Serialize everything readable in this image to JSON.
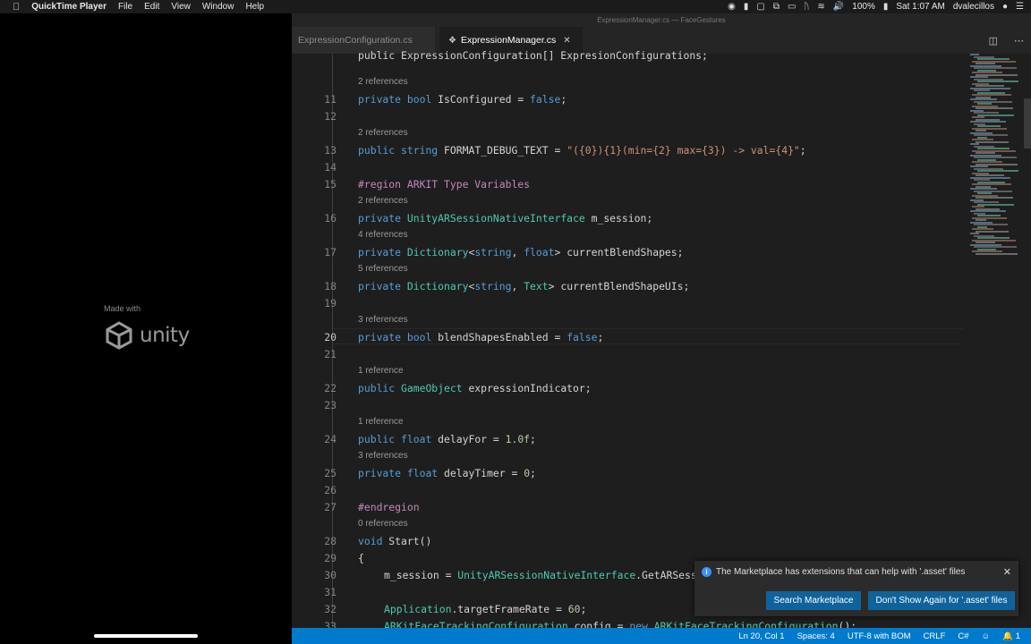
{
  "menubar": {
    "app": "QuickTime Player",
    "items": [
      "File",
      "Edit",
      "View",
      "Window",
      "Help"
    ],
    "battery": "100%",
    "clock": "Sat 1:07 AM",
    "user": "dvalecillos"
  },
  "splash": {
    "made_with": "Made with",
    "logo_text": "unity"
  },
  "editor": {
    "window_title": "ExpressionManager.cs — FaceGestures",
    "tabs": [
      {
        "label": "ExpressionConfiguration.cs"
      },
      {
        "label": "ExpressionManager.cs"
      }
    ]
  },
  "code": {
    "partial_line_10": "public ExpressionConfiguration[] ExpresionConfigurations;",
    "lines": [
      {
        "n": "11",
        "ref": "2 references",
        "parts": [
          [
            "k",
            "private "
          ],
          [
            "k",
            "bool "
          ],
          [
            "p",
            "IsConfigured = "
          ],
          [
            "k",
            "false"
          ],
          [
            "p",
            ";"
          ]
        ]
      },
      {
        "n": "12",
        "parts": []
      },
      {
        "n": "13",
        "ref": "2 references",
        "parts": [
          [
            "k",
            "public "
          ],
          [
            "k",
            "string "
          ],
          [
            "p",
            "FORMAT_DEBUG_TEXT = "
          ],
          [
            "s",
            "\"({0}){1}(min={2} max={3}) -> val={4}\""
          ],
          [
            "p",
            ";"
          ]
        ]
      },
      {
        "n": "14",
        "parts": []
      },
      {
        "n": "15",
        "parts": [
          [
            "rg",
            "#region ARKIT Type Variables"
          ]
        ]
      },
      {
        "n": "16",
        "ref": "2 references",
        "parts": [
          [
            "k",
            "private "
          ],
          [
            "t",
            "UnityARSessionNativeInterface "
          ],
          [
            "p",
            "m_session;"
          ]
        ]
      },
      {
        "n": "17",
        "ref": "4 references",
        "parts": [
          [
            "k",
            "private "
          ],
          [
            "t",
            "Dictionary"
          ],
          [
            "p",
            "<"
          ],
          [
            "k",
            "string"
          ],
          [
            "p",
            ", "
          ],
          [
            "k",
            "float"
          ],
          [
            "p",
            "> currentBlendShapes;"
          ]
        ]
      },
      {
        "n": "18",
        "ref": "5 references",
        "parts": [
          [
            "k",
            "private "
          ],
          [
            "t",
            "Dictionary"
          ],
          [
            "p",
            "<"
          ],
          [
            "k",
            "string"
          ],
          [
            "p",
            ", "
          ],
          [
            "t",
            "Text"
          ],
          [
            "p",
            "> currentBlendShapeUIs;"
          ]
        ]
      },
      {
        "n": "19",
        "parts": []
      },
      {
        "n": "20",
        "ref": "3 references",
        "current": true,
        "parts": [
          [
            "k",
            "private "
          ],
          [
            "k",
            "bool "
          ],
          [
            "p",
            "blendShapesEnabled = "
          ],
          [
            "k",
            "false"
          ],
          [
            "p",
            ";"
          ]
        ]
      },
      {
        "n": "21",
        "parts": []
      },
      {
        "n": "22",
        "ref": "1 reference",
        "parts": [
          [
            "k",
            "public "
          ],
          [
            "t",
            "GameObject "
          ],
          [
            "p",
            "expressionIndicator;"
          ]
        ]
      },
      {
        "n": "23",
        "parts": []
      },
      {
        "n": "24",
        "ref": "1 reference",
        "parts": [
          [
            "k",
            "public "
          ],
          [
            "k",
            "float "
          ],
          [
            "p",
            "delayFor = "
          ],
          [
            "n",
            "1.0f"
          ],
          [
            "p",
            ";"
          ]
        ]
      },
      {
        "n": "25",
        "ref": "3 references",
        "parts": [
          [
            "k",
            "private "
          ],
          [
            "k",
            "float "
          ],
          [
            "p",
            "delayTimer = "
          ],
          [
            "n",
            "0"
          ],
          [
            "p",
            ";"
          ]
        ]
      },
      {
        "n": "26",
        "parts": []
      },
      {
        "n": "27",
        "parts": [
          [
            "rg",
            "#endregion"
          ]
        ]
      },
      {
        "n": "28",
        "ref": "0 references",
        "parts": [
          [
            "k",
            "void "
          ],
          [
            "p",
            "Start()"
          ]
        ]
      },
      {
        "n": "29",
        "parts": [
          [
            "p",
            "{"
          ]
        ]
      },
      {
        "n": "30",
        "indent": 1,
        "parts": [
          [
            "p",
            "m_session = "
          ],
          [
            "t",
            "UnityARSessionNativeInterface"
          ],
          [
            "p",
            ".GetARSessionNativeInterface();"
          ]
        ]
      },
      {
        "n": "31",
        "parts": []
      },
      {
        "n": "32",
        "indent": 1,
        "parts": [
          [
            "t",
            "Application"
          ],
          [
            "p",
            ".targetFrameRate = "
          ],
          [
            "n",
            "60"
          ],
          [
            "p",
            ";"
          ]
        ]
      },
      {
        "n": "33",
        "indent": 1,
        "parts": [
          [
            "t",
            "ARKitFaceTrackingConfiguration "
          ],
          [
            "p",
            "config = "
          ],
          [
            "k",
            "new "
          ],
          [
            "t",
            "ARKitFaceTrackingConfiguration"
          ],
          [
            "p",
            "();"
          ]
        ]
      }
    ]
  },
  "notification": {
    "message": "The Marketplace has extensions that can help with '.asset' files",
    "buttons": [
      "Search Marketplace",
      "Don't Show Again for '.asset' files"
    ]
  },
  "statusbar": {
    "position": "Ln 20, Col 1",
    "spaces": "Spaces: 4",
    "encoding": "UTF-8 with BOM",
    "eol": "CRLF",
    "language": "C#",
    "notifications": "1"
  },
  "colors": {
    "keyword": "#569cd6",
    "type": "#4ec9b0",
    "string": "#ce9178",
    "number": "#b5cea8",
    "region": "#c586c0",
    "statusbar": "#007acc",
    "button": "#0e639c"
  }
}
